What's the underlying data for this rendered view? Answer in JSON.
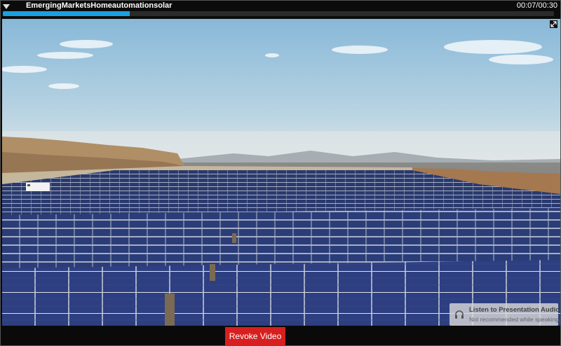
{
  "player": {
    "title": "EmergingMarketsHomeautomationsolar",
    "time": "00:07/00:30",
    "progress": 0.23
  },
  "video": {
    "scene": "solar-farm-aerial"
  },
  "audio_overlay": {
    "title": "Listen to Presentation Audio",
    "subtitle": "Not recommended while speaking."
  },
  "actions": {
    "revoke_label": "Revoke Video"
  },
  "colors": {
    "accent": "#1aa0e2",
    "revoke": "#d81f1f"
  },
  "icons": [
    "collapse-arrow-icon",
    "expand-icon",
    "headset-icon"
  ]
}
